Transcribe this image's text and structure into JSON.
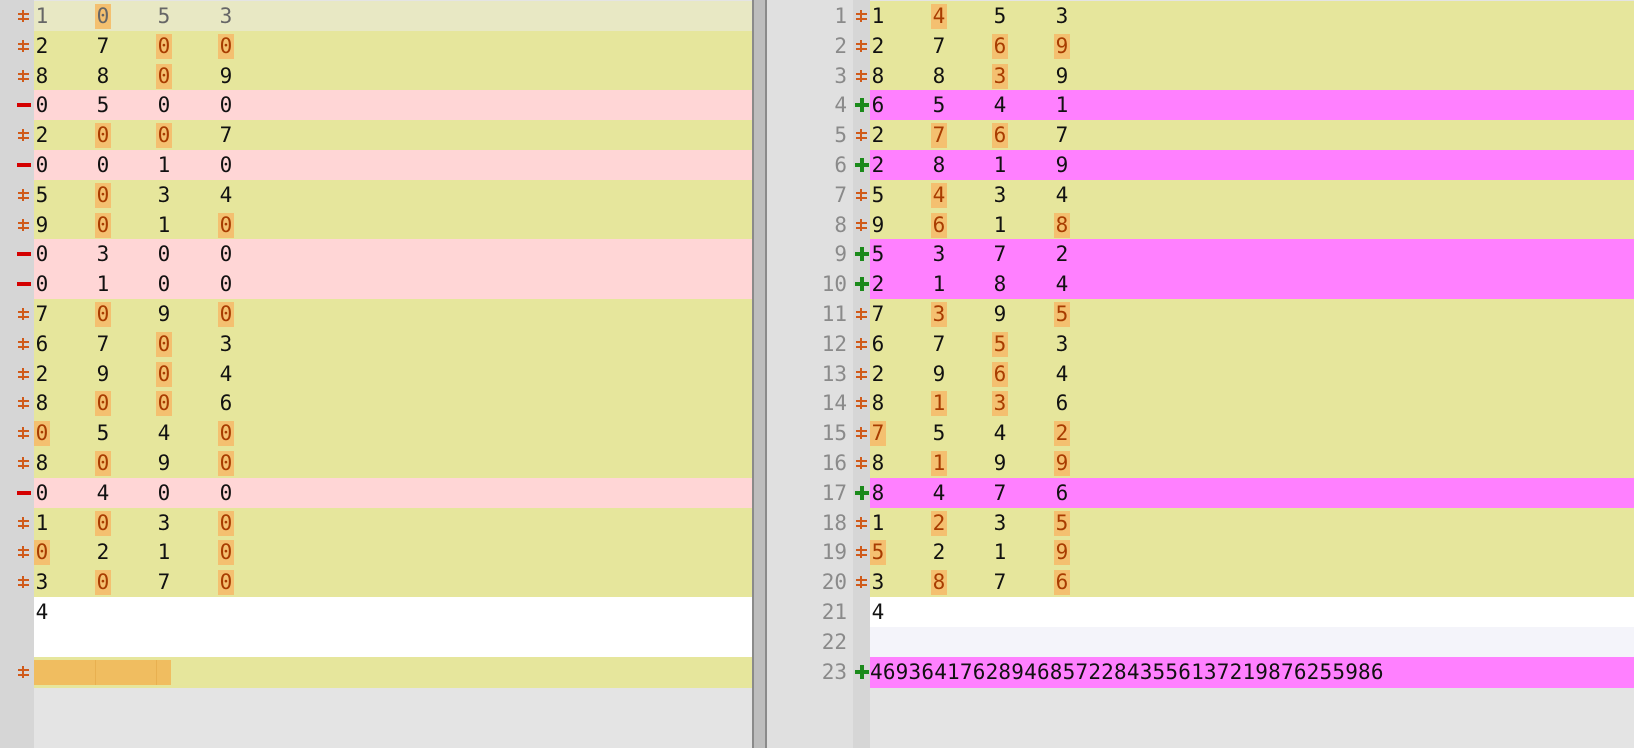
{
  "left_rows": [
    {
      "kind": "changed",
      "cells": [
        "1",
        "0",
        "5",
        "3"
      ],
      "hl": [
        1
      ],
      "first": true
    },
    {
      "kind": "changed",
      "cells": [
        "2",
        "7",
        "0",
        "0"
      ],
      "hl": [
        2,
        3
      ]
    },
    {
      "kind": "changed",
      "cells": [
        "8",
        "8",
        "0",
        "9"
      ],
      "hl": [
        2
      ]
    },
    {
      "kind": "deleted",
      "cells": [
        "0",
        "5",
        "0",
        "0"
      ],
      "hl": []
    },
    {
      "kind": "changed",
      "cells": [
        "2",
        "0",
        "0",
        "7"
      ],
      "hl": [
        1,
        2
      ]
    },
    {
      "kind": "deleted",
      "cells": [
        "0",
        "0",
        "1",
        "0"
      ],
      "hl": []
    },
    {
      "kind": "changed",
      "cells": [
        "5",
        "0",
        "3",
        "4"
      ],
      "hl": [
        1
      ]
    },
    {
      "kind": "changed",
      "cells": [
        "9",
        "0",
        "1",
        "0"
      ],
      "hl": [
        1,
        3
      ]
    },
    {
      "kind": "deleted",
      "cells": [
        "0",
        "3",
        "0",
        "0"
      ],
      "hl": []
    },
    {
      "kind": "deleted",
      "cells": [
        "0",
        "1",
        "0",
        "0"
      ],
      "hl": []
    },
    {
      "kind": "changed",
      "cells": [
        "7",
        "0",
        "9",
        "0"
      ],
      "hl": [
        1,
        3
      ]
    },
    {
      "kind": "changed",
      "cells": [
        "6",
        "7",
        "0",
        "3"
      ],
      "hl": [
        2
      ]
    },
    {
      "kind": "changed",
      "cells": [
        "2",
        "9",
        "0",
        "4"
      ],
      "hl": [
        2
      ]
    },
    {
      "kind": "changed",
      "cells": [
        "8",
        "0",
        "0",
        "6"
      ],
      "hl": [
        1,
        2
      ]
    },
    {
      "kind": "changed",
      "cells": [
        "0",
        "5",
        "4",
        "0"
      ],
      "hl": [
        0,
        3
      ]
    },
    {
      "kind": "changed",
      "cells": [
        "8",
        "0",
        "9",
        "0"
      ],
      "hl": [
        1,
        3
      ]
    },
    {
      "kind": "deleted",
      "cells": [
        "0",
        "4",
        "0",
        "0"
      ],
      "hl": []
    },
    {
      "kind": "changed",
      "cells": [
        "1",
        "0",
        "3",
        "0"
      ],
      "hl": [
        1,
        3
      ]
    },
    {
      "kind": "changed",
      "cells": [
        "0",
        "2",
        "1",
        "0"
      ],
      "hl": [
        0,
        3
      ]
    },
    {
      "kind": "changed",
      "cells": [
        "3",
        "0",
        "7",
        "0"
      ],
      "hl": [
        1,
        3
      ]
    },
    {
      "kind": "plain",
      "cells": [
        "4"
      ],
      "hl": []
    },
    {
      "kind": "plain",
      "cells": [],
      "hl": []
    },
    {
      "kind": "changed_bar",
      "cells": [],
      "hl": []
    }
  ],
  "right_rows": [
    {
      "n": "1",
      "kind": "changed",
      "cells": [
        "1",
        "4",
        "5",
        "3"
      ],
      "hl": [
        1
      ]
    },
    {
      "n": "2",
      "kind": "changed",
      "cells": [
        "2",
        "7",
        "6",
        "9"
      ],
      "hl": [
        2,
        3
      ]
    },
    {
      "n": "3",
      "kind": "changed",
      "cells": [
        "8",
        "8",
        "3",
        "9"
      ],
      "hl": [
        2
      ]
    },
    {
      "n": "4",
      "kind": "added",
      "cells": [
        "6",
        "5",
        "4",
        "1"
      ],
      "hl": []
    },
    {
      "n": "5",
      "kind": "changed",
      "cells": [
        "2",
        "7",
        "6",
        "7"
      ],
      "hl": [
        1,
        2
      ]
    },
    {
      "n": "6",
      "kind": "added",
      "cells": [
        "2",
        "8",
        "1",
        "9"
      ],
      "hl": []
    },
    {
      "n": "7",
      "kind": "changed",
      "cells": [
        "5",
        "4",
        "3",
        "4"
      ],
      "hl": [
        1
      ]
    },
    {
      "n": "8",
      "kind": "changed",
      "cells": [
        "9",
        "6",
        "1",
        "8"
      ],
      "hl": [
        1,
        3
      ]
    },
    {
      "n": "9",
      "kind": "added",
      "cells": [
        "5",
        "3",
        "7",
        "2"
      ],
      "hl": []
    },
    {
      "n": "10",
      "kind": "added",
      "cells": [
        "2",
        "1",
        "8",
        "4"
      ],
      "hl": []
    },
    {
      "n": "11",
      "kind": "changed",
      "cells": [
        "7",
        "3",
        "9",
        "5"
      ],
      "hl": [
        1,
        3
      ]
    },
    {
      "n": "12",
      "kind": "changed",
      "cells": [
        "6",
        "7",
        "5",
        "3"
      ],
      "hl": [
        2
      ]
    },
    {
      "n": "13",
      "kind": "changed",
      "cells": [
        "2",
        "9",
        "6",
        "4"
      ],
      "hl": [
        2
      ]
    },
    {
      "n": "14",
      "kind": "changed",
      "cells": [
        "8",
        "1",
        "3",
        "6"
      ],
      "hl": [
        1,
        2
      ]
    },
    {
      "n": "15",
      "kind": "changed",
      "cells": [
        "7",
        "5",
        "4",
        "2"
      ],
      "hl": [
        0,
        3
      ]
    },
    {
      "n": "16",
      "kind": "changed",
      "cells": [
        "8",
        "1",
        "9",
        "9"
      ],
      "hl": [
        1,
        3
      ]
    },
    {
      "n": "17",
      "kind": "added",
      "cells": [
        "8",
        "4",
        "7",
        "6"
      ],
      "hl": []
    },
    {
      "n": "18",
      "kind": "changed",
      "cells": [
        "1",
        "2",
        "3",
        "5"
      ],
      "hl": [
        1,
        3
      ]
    },
    {
      "n": "19",
      "kind": "changed",
      "cells": [
        "5",
        "2",
        "1",
        "9"
      ],
      "hl": [
        0,
        3
      ]
    },
    {
      "n": "20",
      "kind": "changed",
      "cells": [
        "3",
        "8",
        "7",
        "6"
      ],
      "hl": [
        1,
        3
      ]
    },
    {
      "n": "21",
      "kind": "plain",
      "cells": [
        "4"
      ],
      "hl": []
    },
    {
      "n": "22",
      "kind": "blank",
      "cells": [],
      "hl": []
    },
    {
      "n": "23",
      "kind": "added_long",
      "text": "46936417628946857228435561372198762559 86"
    }
  ],
  "colors": {
    "changed": "#e6e69c",
    "deleted": "#ffd6d6",
    "added": "#ff80ff",
    "highlight": "#f4c070",
    "changed_marker": "#d05a1a",
    "deleted_marker": "#d40000",
    "added_marker": "#1a8a1a"
  },
  "icons": {
    "changed": "changed-line-icon",
    "deleted": "deleted-line-icon",
    "added": "added-line-icon"
  }
}
